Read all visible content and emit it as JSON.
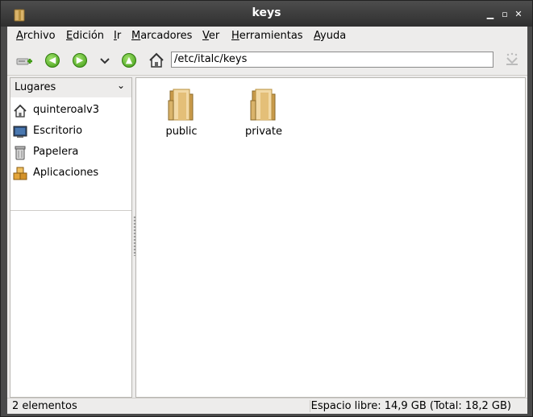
{
  "window": {
    "title": "keys"
  },
  "menubar": {
    "items": [
      {
        "u": "A",
        "rest": "rchivo"
      },
      {
        "u": "E",
        "rest": "dición"
      },
      {
        "u": "I",
        "rest": "r"
      },
      {
        "u": "M",
        "rest": "arcadores"
      },
      {
        "u": "V",
        "rest": "er"
      },
      {
        "u": "H",
        "rest": "erramientas"
      },
      {
        "u": "A",
        "rest": "yuda"
      }
    ]
  },
  "toolbar": {
    "location": "/etc/italc/keys"
  },
  "sidebar": {
    "header": "Lugares",
    "places": [
      {
        "label": "quinteroalv3",
        "icon": "home-icon"
      },
      {
        "label": "Escritorio",
        "icon": "desktop-icon"
      },
      {
        "label": "Papelera",
        "icon": "trash-icon"
      },
      {
        "label": "Aplicaciones",
        "icon": "applications-icon"
      }
    ]
  },
  "files": [
    {
      "name": "public",
      "icon": "folder-icon"
    },
    {
      "name": "private",
      "icon": "folder-icon"
    }
  ],
  "status": {
    "count": "2 elementos",
    "free_space": "Espacio libre: 14,9 GB (Total: 18,2 GB)"
  }
}
